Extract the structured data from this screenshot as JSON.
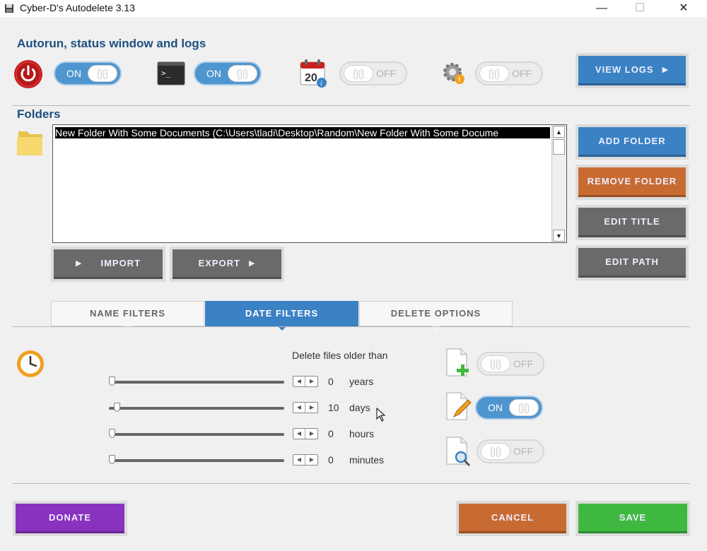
{
  "window": {
    "title": "Cyber-D's Autodelete 3.13",
    "minimize": "—",
    "maximize": "☐",
    "close": "✕"
  },
  "autorun": {
    "title": "Autorun, status window and logs",
    "toggles": [
      {
        "icon": "power-icon",
        "state": "ON"
      },
      {
        "icon": "console-icon",
        "state": "ON"
      },
      {
        "icon": "calendar-icon",
        "state": "OFF"
      },
      {
        "icon": "gear-warning-icon",
        "state": "OFF"
      }
    ],
    "view_logs_label": "VIEW LOGS"
  },
  "folders": {
    "title": "Folders",
    "items": [
      "New Folder With Some Documents   (C:\\Users\\tladi\\Desktop\\Random\\New Folder With Some Docume"
    ],
    "add_label": "ADD FOLDER",
    "remove_label": "REMOVE FOLDER",
    "edit_title_label": "EDIT TITLE",
    "edit_path_label": "EDIT PATH",
    "import_label": "IMPORT",
    "export_label": "EXPORT"
  },
  "tabs": {
    "name_filters": "NAME FILTERS",
    "date_filters": "DATE FILTERS",
    "delete_options": "DELETE OPTIONS",
    "active": "DATE FILTERS"
  },
  "date_filters": {
    "heading": "Delete files older than",
    "rows": [
      {
        "value": "0",
        "unit": "years",
        "slider_fraction": 0.0
      },
      {
        "value": "10",
        "unit": "days",
        "slider_fraction": 0.03
      },
      {
        "value": "0",
        "unit": "hours",
        "slider_fraction": 0.0
      },
      {
        "value": "0",
        "unit": "minutes",
        "slider_fraction": 0.0
      }
    ],
    "side_toggles": [
      {
        "icon": "file-add-icon",
        "state": "OFF"
      },
      {
        "icon": "file-edit-icon",
        "state": "ON"
      },
      {
        "icon": "file-search-icon",
        "state": "OFF"
      }
    ]
  },
  "footer": {
    "donate_label": "DONATE",
    "cancel_label": "CANCEL",
    "save_label": "SAVE"
  },
  "colors": {
    "accent_blue": "#3b82c4",
    "orange": "#c86b32",
    "purple": "#8a32c0",
    "green": "#3fb83f",
    "heading": "#1d4f7f"
  }
}
